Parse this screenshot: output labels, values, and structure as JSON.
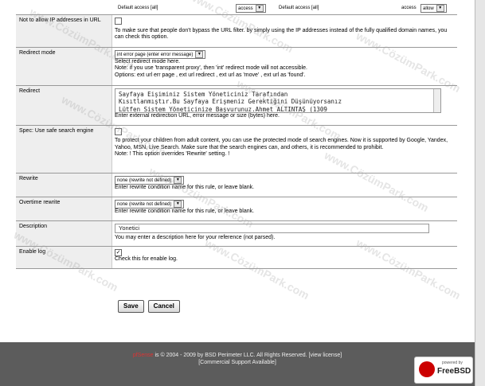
{
  "top_row": {
    "left_text": "Default access [all]",
    "left_select": "access",
    "left_select2": "allow",
    "right_text": "Default access [all]",
    "right_select": "access",
    "right_select2": "allow"
  },
  "rows": {
    "ip": {
      "label": "Not to allow IP addresses in URL",
      "desc": "To make sure that people don't bypass the URL filter. by simply using the IP addresses instead of the fully qualified domain names, you can check this option."
    },
    "redirect_mode": {
      "label": "Redirect mode",
      "select": "int error page (enter error message)",
      "line1": "Select redirect mode here.",
      "line2": "Note: if you use 'transparent proxy', then 'int' redirect mode will not accessible.",
      "line3": "Options: ext url err page , ext url redirect , ext url as 'move' , ext url as 'found'."
    },
    "redirect": {
      "label": "Redirect",
      "text1": "Sayfaya Eişiminiz Sistem Yöneticiniz Tarafından",
      "text2": "Kısıtlanmıştır.Bu Sayfaya Erişmeniz Gerektiğini Düşünüyorsanız",
      "text3": "Lütfen Sistem Yöneticinize Başvurunuz.Ahmet ALTINTAŞ (1309",
      "desc": "Enter external redirection URL, error message or size (bytes) here."
    },
    "safe_search": {
      "label": "Spec: Use safe search engine",
      "desc": "To protect your children from adult content, you can use the protected mode of search engines. Now it is supported by Google, Yandex, Yahoo, MSN, Live Search. Make sure that the search engines can, and others, it is recommended to prohibit.",
      "note": "Note: ! This option overrides 'Rewrite' setting. !"
    },
    "rewrite": {
      "label": "Rewrite",
      "select": "none (rewrite not defined)",
      "desc": "Enter rewrite condition name for this rule, or leave blank."
    },
    "overtime_rewrite": {
      "label": "Overtime rewrite",
      "select": "none (rewrite not defined)",
      "desc": "Enter rewrite condition name for this rule, or leave blank."
    },
    "description": {
      "label": "Description",
      "value": "Yonetici",
      "desc": "You may enter a description here for your reference (not parsed)."
    },
    "enable_log": {
      "label": "Enable log",
      "checked": "✓",
      "desc": "Check this for enable log."
    }
  },
  "buttons": {
    "save": "Save",
    "cancel": "Cancel"
  },
  "footer": {
    "brand": "pfSense",
    "line1": " is © 2004 - 2009 by BSD Perimeter LLC. All Rights Reserved. [view license]",
    "line2": "[Commercial Support Available]",
    "badge_powered": "powered by",
    "badge_name": "FreeBSD"
  },
  "watermark": "www.CözümPark.com"
}
